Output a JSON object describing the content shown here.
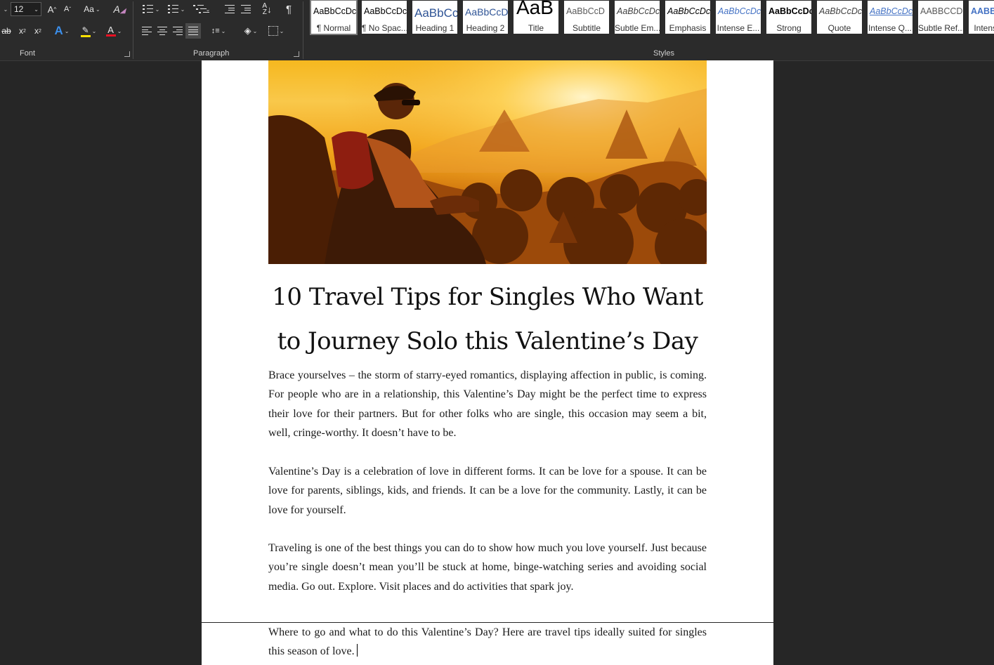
{
  "ribbon": {
    "font_group_label": "Font",
    "paragraph_group_label": "Paragraph",
    "styles_group_label": "Styles",
    "font_size": "12",
    "grow_font": "A",
    "shrink_font": "A",
    "change_case": "Aa",
    "strikethrough": "ab",
    "subscript": "x",
    "superscript": "x",
    "text_effects": "A",
    "font_color_letter": "A",
    "highlight_color": "#ffe100",
    "font_color": "#e81123",
    "styles": [
      {
        "sample": "AaBbCcDc",
        "name": "¶ Normal",
        "color": "#000000",
        "italic": false,
        "bold": false
      },
      {
        "sample": "AaBbCcDc",
        "name": "¶ No Spac...",
        "color": "#000000",
        "italic": false,
        "bold": false
      },
      {
        "sample": "AaBbCc",
        "name": "Heading 1",
        "color": "#2f5496",
        "italic": false,
        "bold": false
      },
      {
        "sample": "AaBbCcD",
        "name": "Heading 2",
        "color": "#2f5496",
        "italic": false,
        "bold": false
      },
      {
        "sample": "AaB",
        "name": "Title",
        "color": "#000000",
        "italic": false,
        "bold": false
      },
      {
        "sample": "AaBbCcD",
        "name": "Subtitle",
        "color": "#5a5a5a",
        "italic": false,
        "bold": false
      },
      {
        "sample": "AaBbCcDc",
        "name": "Subtle Em...",
        "color": "#404040",
        "italic": true,
        "bold": false
      },
      {
        "sample": "AaBbCcDc",
        "name": "Emphasis",
        "color": "#000000",
        "italic": true,
        "bold": false
      },
      {
        "sample": "AaBbCcDc",
        "name": "Intense E...",
        "color": "#4472c4",
        "italic": true,
        "bold": false
      },
      {
        "sample": "AaBbCcDc",
        "name": "Strong",
        "color": "#000000",
        "italic": false,
        "bold": true
      },
      {
        "sample": "AaBbCcDc",
        "name": "Quote",
        "color": "#404040",
        "italic": true,
        "bold": false
      },
      {
        "sample": "AaBbCcDc",
        "name": "Intense Q...",
        "color": "#4472c4",
        "italic": true,
        "bold": false
      },
      {
        "sample": "AABBCCDD",
        "name": "Subtle Ref...",
        "color": "#5a5a5a",
        "italic": false,
        "bold": false
      },
      {
        "sample": "AABBC",
        "name": "Intense...",
        "color": "#4472c4",
        "italic": false,
        "bold": true
      }
    ]
  },
  "document": {
    "title": "10 Travel Tips for Singles Who Want to Journey Solo this Valentine’s Day",
    "paragraphs": [
      "Brace yourselves – the storm of starry-eyed romantics, displaying affection in public, is coming. For people who are in a relationship, this Valentine’s Day might be the perfect time to express their love for their partners. But for other folks who are single, this occasion may seem a bit, well, cringe-worthy. It doesn’t have to be.",
      "Valentine’s Day is a celebration of love in different forms. It can be love for a spouse. It can be love for parents, siblings, kids, and friends. It can be a love for the community. Lastly, it can be love for yourself.",
      "Traveling is one of the best things you can do to show how much you love yourself. Just because you’re single doesn’t mean you’ll be stuck at home, binge-watching series and avoiding social media. Go out. Explore. Visit places and do activities that spark joy.",
      "Where to go and what to do this Valentine’s Day? Here are travel tips ideally suited for singles this season of love."
    ]
  }
}
